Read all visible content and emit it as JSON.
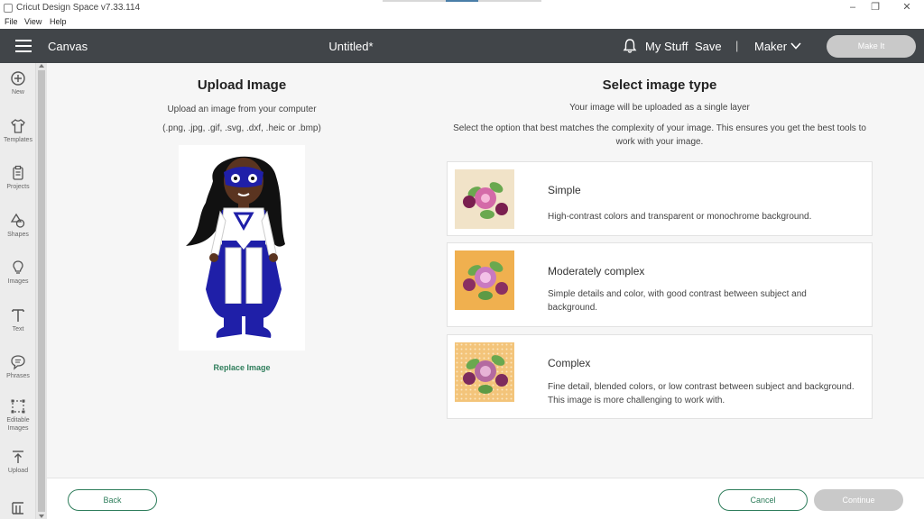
{
  "window": {
    "title": "Cricut Design Space  v7.33.114",
    "minimize_glyph": "–",
    "restore_glyph": "❐",
    "close_glyph": "✕"
  },
  "menu": {
    "file": "File",
    "view": "View",
    "help": "Help"
  },
  "header": {
    "canvas_label": "Canvas",
    "doc_title": "Untitled*",
    "my_stuff": "My Stuff",
    "save": "Save",
    "separator": "|",
    "machine": "Maker",
    "make_it": "Make It"
  },
  "sidebar": {
    "items": [
      {
        "label": "New",
        "icon": "plus-circle-icon"
      },
      {
        "label": "Templates",
        "icon": "shirt-icon"
      },
      {
        "label": "Projects",
        "icon": "clipboard-icon"
      },
      {
        "label": "Shapes",
        "icon": "shapes-icon"
      },
      {
        "label": "Images",
        "icon": "lightbulb-icon"
      },
      {
        "label": "Text",
        "icon": "text-icon"
      },
      {
        "label": "Phrases",
        "icon": "speech-bubble-icon"
      },
      {
        "label": "Editable Images",
        "icon": "editable-images-icon"
      },
      {
        "label": "Upload",
        "icon": "upload-icon"
      }
    ]
  },
  "upload": {
    "title": "Upload Image",
    "description": "Upload an image from your computer",
    "formats": "(.png, .jpg, .gif, .svg, .dxf, .heic or .bmp)",
    "replace_link": "Replace Image"
  },
  "image_type": {
    "title": "Select image type",
    "subtitle": "Your image will be uploaded as a single layer",
    "description": "Select the option that best matches the complexity of your image. This ensures you get the best tools to work with your image.",
    "options": [
      {
        "name": "Simple",
        "description": "High-contrast colors and transparent or monochrome background."
      },
      {
        "name": "Moderately complex",
        "description": "Simple details and color, with good contrast between subject and background."
      },
      {
        "name": "Complex",
        "description": "Fine detail, blended colors, or low contrast between subject and background. This image is more challenging to work with."
      }
    ]
  },
  "footer": {
    "back": "Back",
    "cancel": "Cancel",
    "continue": "Continue"
  },
  "colors": {
    "header_bg": "#414549",
    "accent_green": "#2e7d5b",
    "disabled_button": "#c9c9c9",
    "hero_blue": "#1f1fa8"
  }
}
